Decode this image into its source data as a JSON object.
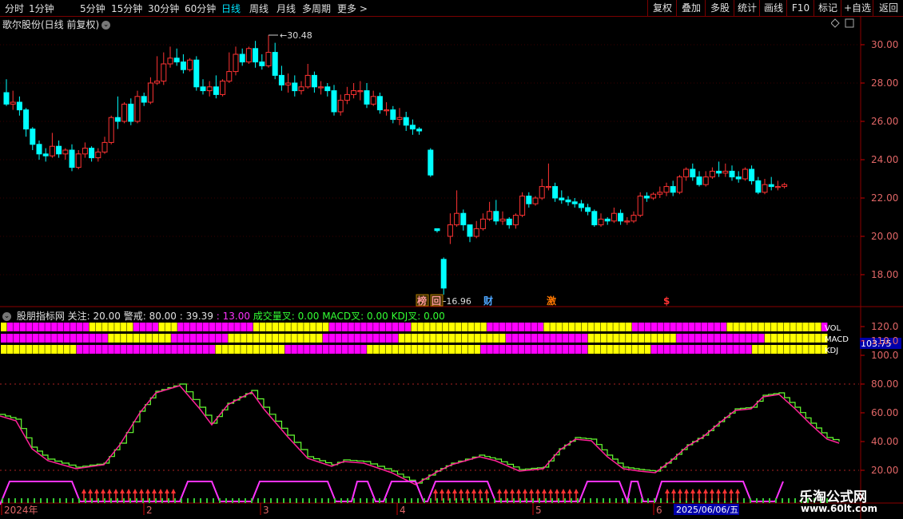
{
  "toolbar": {
    "periods": [
      "分时",
      "1分钟",
      "5分钟",
      "15分钟",
      "30分钟",
      "60分钟",
      "日线",
      "周线",
      "月线",
      "多周期",
      "更多 >"
    ],
    "active_period": "日线",
    "right_buttons": [
      "复权",
      "叠加",
      "多股",
      "统计",
      "画线",
      "F10",
      "+自选",
      "返回",
      "标记"
    ]
  },
  "stock": {
    "name": "歌尔股份(日线 前复权)",
    "max_label": "30.48",
    "min_label": "16.96",
    "events": [
      "榜",
      "回",
      "财",
      "激",
      "$"
    ]
  },
  "indicator": {
    "name": "股朋指标网",
    "params": [
      {
        "label": "关注: 20.00",
        "color": "#e0e0e0"
      },
      {
        "label": "警戒: 80.00",
        "color": "#e0e0e0"
      },
      {
        "label": ": 39.39",
        "color": "#e0e0e0"
      },
      {
        "label": ": 13.00",
        "color": "#ff33ff"
      },
      {
        "label": "成交量叉: 0.00",
        "color": "#33ff33"
      },
      {
        "label": "MACD叉: 0.00",
        "color": "#33ff33"
      },
      {
        "label": "KDJ叉: 0.00",
        "color": "#33ff33"
      }
    ],
    "row_labels": [
      "VOL",
      "MACD",
      "KDJ"
    ],
    "current_value": "103.75"
  },
  "price_axis": [
    "30.00",
    "28.00",
    "26.00",
    "24.00",
    "22.00",
    "20.00",
    "18.00"
  ],
  "indicator_axis": [
    "120.0",
    "110.0",
    "100.0",
    "80.00",
    "60.00",
    "40.00",
    "20.00"
  ],
  "date_axis": [
    "2024年",
    "2",
    "3",
    "4",
    "5",
    "6"
  ],
  "cursor_date": "2025/06/06/五",
  "colors": {
    "up": "#ff3333",
    "down": "#00ffff",
    "magenta": "#ff00ff",
    "yellow": "#ffff00",
    "green": "#33ff33"
  },
  "watermark": {
    "line1": "乐淘公式网",
    "line2": "www.60lt.com"
  },
  "chart_data": {
    "type": "candlestick",
    "ylim": [
      16.5,
      31
    ],
    "candles": [
      [
        27.5,
        28.2,
        26.9,
        26.8
      ],
      [
        26.9,
        27.6,
        27.0,
        26.6
      ],
      [
        27.0,
        27.3,
        26.6,
        26.3
      ],
      [
        26.6,
        26.7,
        25.6,
        25.2
      ],
      [
        25.6,
        25.7,
        24.8,
        24.5
      ],
      [
        24.8,
        25.0,
        24.3,
        24.0
      ],
      [
        24.3,
        24.6,
        24.2,
        23.9
      ],
      [
        24.2,
        25.4,
        24.7,
        24.1
      ],
      [
        24.7,
        25.0,
        24.3,
        24.1
      ],
      [
        24.3,
        24.6,
        24.5,
        24.0
      ],
      [
        24.5,
        24.8,
        23.6,
        23.4
      ],
      [
        23.6,
        24.5,
        24.3,
        23.5
      ],
      [
        24.3,
        24.9,
        24.6,
        24.1
      ],
      [
        24.6,
        24.7,
        24.1,
        23.9
      ],
      [
        24.1,
        24.6,
        24.4,
        23.9
      ],
      [
        24.4,
        25.2,
        24.9,
        24.3
      ],
      [
        24.9,
        26.3,
        26.2,
        24.8
      ],
      [
        26.2,
        27.3,
        26.0,
        25.6
      ],
      [
        26.0,
        27.0,
        26.9,
        25.9
      ],
      [
        26.9,
        27.2,
        26.0,
        25.8
      ],
      [
        26.0,
        27.6,
        27.3,
        25.9
      ],
      [
        27.3,
        27.5,
        27.0,
        26.8
      ],
      [
        27.0,
        28.3,
        28.0,
        26.9
      ],
      [
        28.0,
        29.4,
        28.1,
        27.9
      ],
      [
        28.1,
        29.6,
        29.0,
        27.9
      ],
      [
        29.0,
        29.9,
        29.3,
        28.8
      ],
      [
        29.3,
        29.8,
        29.1,
        28.9
      ],
      [
        29.1,
        29.5,
        28.7,
        28.5
      ],
      [
        28.7,
        29.3,
        29.2,
        28.6
      ],
      [
        29.2,
        29.4,
        27.8,
        27.6
      ],
      [
        27.8,
        28.2,
        27.6,
        27.4
      ],
      [
        27.6,
        28.1,
        27.8,
        27.3
      ],
      [
        27.8,
        28.4,
        27.4,
        27.2
      ],
      [
        27.4,
        28.2,
        28.1,
        27.3
      ],
      [
        28.1,
        29.6,
        28.6,
        28.0
      ],
      [
        28.6,
        29.9,
        29.5,
        28.4
      ],
      [
        29.5,
        29.8,
        29.1,
        28.9
      ],
      [
        29.1,
        29.9,
        29.8,
        29.0
      ],
      [
        29.8,
        30.2,
        29.1,
        28.8
      ],
      [
        29.1,
        29.5,
        28.9,
        28.7
      ],
      [
        28.9,
        30.5,
        29.6,
        28.8
      ],
      [
        29.6,
        30.1,
        28.4,
        28.2
      ],
      [
        28.4,
        28.9,
        27.9,
        27.6
      ],
      [
        27.9,
        28.5,
        28.0,
        27.5
      ],
      [
        28.0,
        28.4,
        27.6,
        27.3
      ],
      [
        27.6,
        28.1,
        27.8,
        27.4
      ],
      [
        27.8,
        29.0,
        28.4,
        27.7
      ],
      [
        28.4,
        28.6,
        27.8,
        27.5
      ],
      [
        27.8,
        28.1,
        27.8,
        27.4
      ],
      [
        27.8,
        28.0,
        27.6,
        27.3
      ],
      [
        27.6,
        27.9,
        26.5,
        26.3
      ],
      [
        26.5,
        27.4,
        27.1,
        26.3
      ],
      [
        27.1,
        27.8,
        27.4,
        26.9
      ],
      [
        27.4,
        28.0,
        27.6,
        27.2
      ],
      [
        27.6,
        28.1,
        27.6,
        27.1
      ],
      [
        27.6,
        28.0,
        26.9,
        26.7
      ],
      [
        26.9,
        27.6,
        27.3,
        26.8
      ],
      [
        27.3,
        27.5,
        26.6,
        26.4
      ],
      [
        26.6,
        27.0,
        26.6,
        26.3
      ],
      [
        26.6,
        26.8,
        26.1,
        25.9
      ],
      [
        26.1,
        26.7,
        26.2,
        25.8
      ],
      [
        26.2,
        26.5,
        25.8,
        25.5
      ],
      [
        25.8,
        26.1,
        25.6,
        25.3
      ],
      [
        25.6,
        25.7,
        25.5,
        25.3
      ],
      [
        24.5,
        24.6,
        23.2,
        23.1
      ],
      [
        20.4,
        20.4,
        20.3,
        20.2
      ],
      [
        18.8,
        18.9,
        17.3,
        16.96
      ],
      [
        20.0,
        21.2,
        20.6,
        19.6
      ],
      [
        20.6,
        22.4,
        21.2,
        20.5
      ],
      [
        21.2,
        21.4,
        20.6,
        20.3
      ],
      [
        20.6,
        20.6,
        20.0,
        19.7
      ],
      [
        20.0,
        20.8,
        20.4,
        19.9
      ],
      [
        20.4,
        21.2,
        20.9,
        20.3
      ],
      [
        20.9,
        21.8,
        21.3,
        20.8
      ],
      [
        21.3,
        21.9,
        20.8,
        20.6
      ],
      [
        20.8,
        21.3,
        20.9,
        20.6
      ],
      [
        20.9,
        21.0,
        20.6,
        20.4
      ],
      [
        20.6,
        21.2,
        21.1,
        20.4
      ],
      [
        21.1,
        22.3,
        22.1,
        21.0
      ],
      [
        22.1,
        22.3,
        21.7,
        21.5
      ],
      [
        21.7,
        22.1,
        22.0,
        21.6
      ],
      [
        22.0,
        23.0,
        22.6,
        21.9
      ],
      [
        22.6,
        23.8,
        22.6,
        22.4
      ],
      [
        22.6,
        22.8,
        22.0,
        21.8
      ],
      [
        22.0,
        22.4,
        21.9,
        21.7
      ],
      [
        21.9,
        22.1,
        21.8,
        21.6
      ],
      [
        21.8,
        22.0,
        21.7,
        21.5
      ],
      [
        21.7,
        21.9,
        21.5,
        21.3
      ],
      [
        21.5,
        21.7,
        21.3,
        21.1
      ],
      [
        21.3,
        21.4,
        20.6,
        20.5
      ],
      [
        20.6,
        21.2,
        20.9,
        20.5
      ],
      [
        20.9,
        21.0,
        20.8,
        20.6
      ],
      [
        20.8,
        21.5,
        21.2,
        20.7
      ],
      [
        21.2,
        21.4,
        20.8,
        20.6
      ],
      [
        20.8,
        21.0,
        20.8,
        20.6
      ],
      [
        20.8,
        21.3,
        21.1,
        20.7
      ],
      [
        21.1,
        22.3,
        22.1,
        21.0
      ],
      [
        22.1,
        22.3,
        22.0,
        21.8
      ],
      [
        22.0,
        22.3,
        22.2,
        21.9
      ],
      [
        22.2,
        22.6,
        22.3,
        22.0
      ],
      [
        22.3,
        22.8,
        22.6,
        22.1
      ],
      [
        22.6,
        22.9,
        22.3,
        22.1
      ],
      [
        22.3,
        23.2,
        23.1,
        22.2
      ],
      [
        23.1,
        23.6,
        23.5,
        22.9
      ],
      [
        23.5,
        23.8,
        23.1,
        22.9
      ],
      [
        23.1,
        23.4,
        22.7,
        22.6
      ],
      [
        22.7,
        23.4,
        23.1,
        22.6
      ],
      [
        23.1,
        23.6,
        23.4,
        23.0
      ],
      [
        23.4,
        23.9,
        23.3,
        23.1
      ],
      [
        23.3,
        23.8,
        23.4,
        23.1
      ],
      [
        23.4,
        23.7,
        23.1,
        22.9
      ],
      [
        23.1,
        23.4,
        23.0,
        22.8
      ],
      [
        23.0,
        23.6,
        23.5,
        22.9
      ],
      [
        23.5,
        23.7,
        22.9,
        22.7
      ],
      [
        22.9,
        23.1,
        22.3,
        22.2
      ],
      [
        22.3,
        23.0,
        22.7,
        22.2
      ],
      [
        22.7,
        23.1,
        22.6,
        22.4
      ],
      [
        22.6,
        22.9,
        22.6,
        22.4
      ],
      [
        22.6,
        22.8,
        22.7,
        22.5
      ]
    ]
  }
}
